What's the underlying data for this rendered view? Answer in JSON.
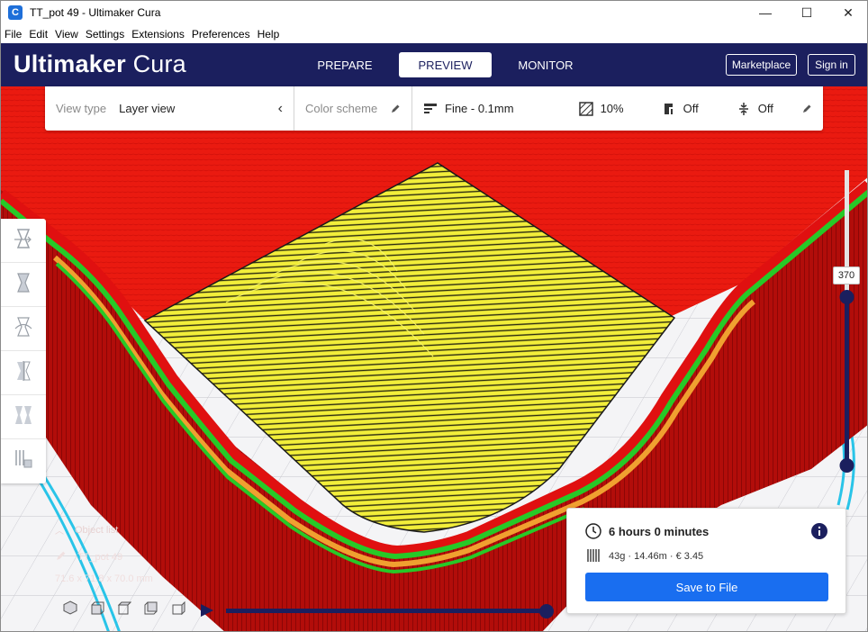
{
  "window": {
    "title": "TT_pot 49 - Ultimaker Cura",
    "app_icon": "C",
    "controls": {
      "minimize": "—",
      "maximize": "☐",
      "close": "✕"
    }
  },
  "menu": [
    "File",
    "Edit",
    "View",
    "Settings",
    "Extensions",
    "Preferences",
    "Help"
  ],
  "header": {
    "brand_bold": "Ultimaker",
    "brand_light": "Cura",
    "stages": [
      "PREPARE",
      "PREVIEW",
      "MONITOR"
    ],
    "active_stage": "PREVIEW",
    "marketplace": "Marketplace",
    "signin": "Sign in"
  },
  "viewbar": {
    "view_type_label": "View type",
    "view_type_value": "Layer view",
    "color_scheme_label": "Color scheme",
    "profile": "Fine - 0.1mm",
    "infill": "10%",
    "support": "Off",
    "adhesion": "Off"
  },
  "tools": [
    "move-tool-icon",
    "scale-tool-icon",
    "rotate-tool-icon",
    "mirror-tool-icon",
    "per-model-settings-icon",
    "support-blocker-icon"
  ],
  "object_list": {
    "toggle_label": "Object list",
    "object_name": "TT_pot 49",
    "dimensions": "71.6 x 71.8 x 70.0 mm"
  },
  "layer_slider": {
    "current_layer": "370",
    "position_fraction": 0.57
  },
  "print_info": {
    "time": "6 hours 0 minutes",
    "material": "43g · 14.46m · € 3.45",
    "save_button": "Save to File"
  },
  "colors": {
    "header": "#1b1f5e",
    "accent": "#196ef0",
    "wall_red": "#e01010",
    "infill_yellow": "#f2f23a",
    "skin_green": "#2ed42e",
    "orange": "#f0a030",
    "travel_cyan": "#29c4e8"
  }
}
